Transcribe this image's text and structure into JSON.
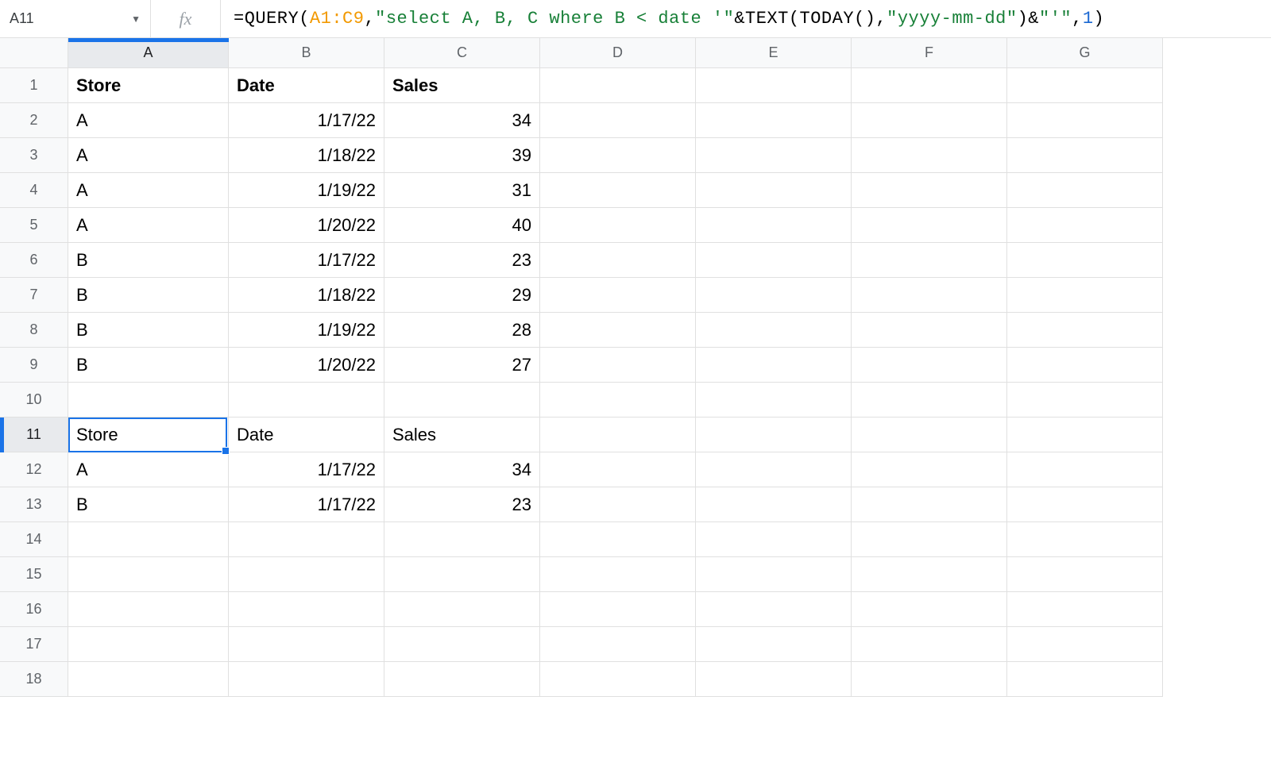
{
  "nameBox": "A11",
  "fxLabel": "fx",
  "formula": {
    "p1": "=QUERY(",
    "p2": "A1:C9",
    "p3": ",",
    "p4": "\"select A, B, C where B < date '\"",
    "p5": "&TEXT(TODAY(),",
    "p6": "\"yyyy-mm-dd\"",
    "p7": ")&",
    "p8": "\"'\"",
    "p9": ",",
    "p10": "1",
    "p11": ")"
  },
  "columns": [
    "A",
    "B",
    "C",
    "D",
    "E",
    "F",
    "G"
  ],
  "rowCount": 18,
  "activeColIndex": 0,
  "activeRowIndex": 10,
  "data": {
    "1": {
      "A": {
        "v": "Store",
        "b": true
      },
      "B": {
        "v": "Date",
        "b": true
      },
      "C": {
        "v": "Sales",
        "b": true
      }
    },
    "2": {
      "A": {
        "v": "A"
      },
      "B": {
        "v": "1/17/22",
        "r": true
      },
      "C": {
        "v": "34",
        "r": true
      }
    },
    "3": {
      "A": {
        "v": "A"
      },
      "B": {
        "v": "1/18/22",
        "r": true
      },
      "C": {
        "v": "39",
        "r": true
      }
    },
    "4": {
      "A": {
        "v": "A"
      },
      "B": {
        "v": "1/19/22",
        "r": true
      },
      "C": {
        "v": "31",
        "r": true
      }
    },
    "5": {
      "A": {
        "v": "A"
      },
      "B": {
        "v": "1/20/22",
        "r": true
      },
      "C": {
        "v": "40",
        "r": true
      }
    },
    "6": {
      "A": {
        "v": "B"
      },
      "B": {
        "v": "1/17/22",
        "r": true
      },
      "C": {
        "v": "23",
        "r": true
      }
    },
    "7": {
      "A": {
        "v": "B"
      },
      "B": {
        "v": "1/18/22",
        "r": true
      },
      "C": {
        "v": "29",
        "r": true
      }
    },
    "8": {
      "A": {
        "v": "B"
      },
      "B": {
        "v": "1/19/22",
        "r": true
      },
      "C": {
        "v": "28",
        "r": true
      }
    },
    "9": {
      "A": {
        "v": "B"
      },
      "B": {
        "v": "1/20/22",
        "r": true
      },
      "C": {
        "v": "27",
        "r": true
      }
    },
    "11": {
      "A": {
        "v": "Store"
      },
      "B": {
        "v": "Date"
      },
      "C": {
        "v": "Sales"
      }
    },
    "12": {
      "A": {
        "v": "A"
      },
      "B": {
        "v": "1/17/22",
        "r": true
      },
      "C": {
        "v": "34",
        "r": true
      }
    },
    "13": {
      "A": {
        "v": "B"
      },
      "B": {
        "v": "1/17/22",
        "r": true
      },
      "C": {
        "v": "23",
        "r": true
      }
    }
  }
}
